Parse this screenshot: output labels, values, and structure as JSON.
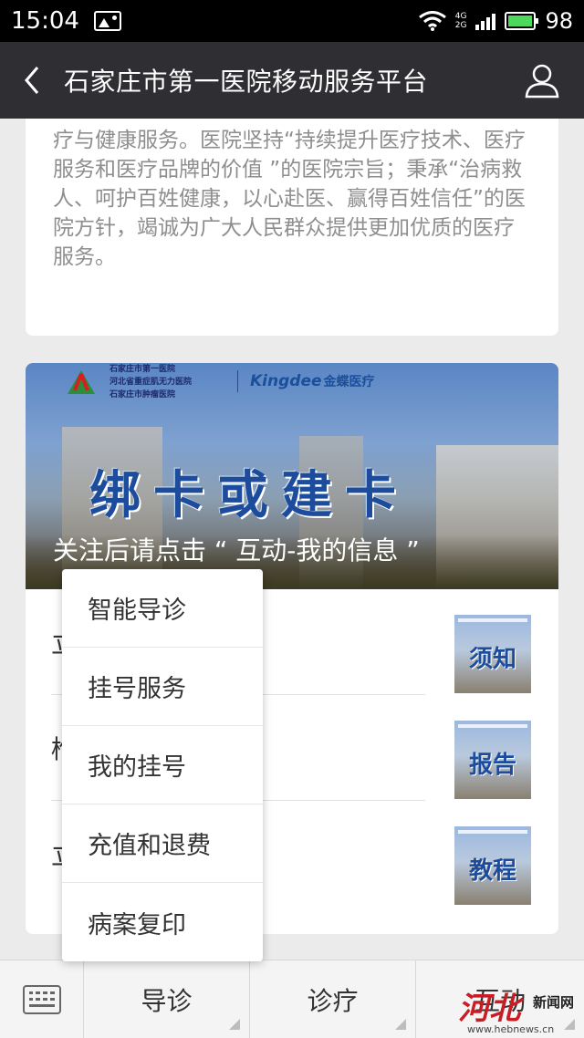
{
  "status_bar": {
    "time": "15:04",
    "net_top": "4G",
    "net_bottom": "2G",
    "battery_level": "98",
    "battery_color": "#4cd95b"
  },
  "header": {
    "title": "石家庄市第一医院移动服务平台",
    "back_icon": "chevron-left-icon",
    "user_icon": "user-icon"
  },
  "intro": {
    "text": "疗与健康服务。医院坚持“持续提升医疗技术、医疗服务和医疗品牌的价值 ”的医院宗旨；秉承“治病救人、呵护百姓健康，以心赴医、赢得百姓信任”的医院方针，竭诚为广大人民群众提供更加优质的医疗服务。"
  },
  "banner": {
    "hospital_names": [
      "石家庄市第一医院",
      "河北省重症肌无力医院",
      "石家庄市肿瘤医院"
    ],
    "brand": "Kingdee",
    "brand_cn": "金蝶医疗",
    "title": "绑卡或建卡",
    "caption": "关注后请点击 “ 互动-我的信息 ”"
  },
  "menu_rows": [
    {
      "partial_text": "立",
      "thumb_label": "须知"
    },
    {
      "partial_text": "椎",
      "thumb_label": "报告"
    },
    {
      "partial_text": "立",
      "thumb_label": "教程"
    }
  ],
  "popup": {
    "items": [
      "智能导诊",
      "挂号服务",
      "我的挂号",
      "充值和退费",
      "病案复印"
    ]
  },
  "bottom_bar": {
    "keyboard_icon": "keyboard-icon",
    "tabs": [
      "导诊",
      "诊疗",
      "互动"
    ]
  },
  "watermark": {
    "logo": "河北",
    "name": "新闻网",
    "url": "www.hebnews.cn"
  },
  "colors": {
    "header_bg": "#2f2f33",
    "banner_title": "#1d4c9c",
    "watermark_red": "#c81d25"
  }
}
